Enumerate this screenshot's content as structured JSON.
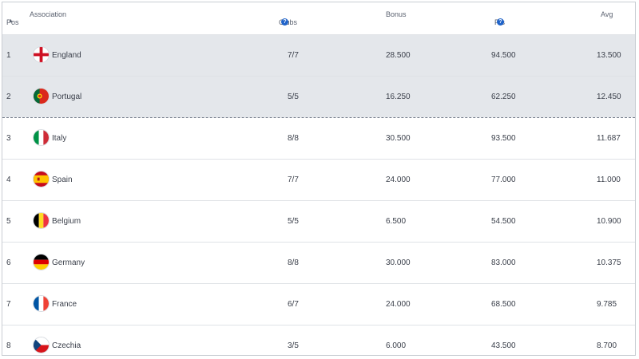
{
  "header": {
    "pos": "Pos",
    "association": "Association",
    "clubs": "Clubs",
    "bonus": "Bonus",
    "pts": "Pts",
    "avg": "Avg"
  },
  "rows": [
    {
      "pos": "1",
      "name": "England",
      "clubs": "7/7",
      "bonus": "28.500",
      "pts": "94.500",
      "avg": "13.500",
      "flag": "england-flag-icon"
    },
    {
      "pos": "2",
      "name": "Portugal",
      "clubs": "5/5",
      "bonus": "16.250",
      "pts": "62.250",
      "avg": "12.450",
      "flag": "portugal-flag-icon"
    },
    {
      "pos": "3",
      "name": "Italy",
      "clubs": "8/8",
      "bonus": "30.500",
      "pts": "93.500",
      "avg": "11.687",
      "flag": "italy-flag-icon"
    },
    {
      "pos": "4",
      "name": "Spain",
      "clubs": "7/7",
      "bonus": "24.000",
      "pts": "77.000",
      "avg": "11.000",
      "flag": "spain-flag-icon"
    },
    {
      "pos": "5",
      "name": "Belgium",
      "clubs": "5/5",
      "bonus": "6.500",
      "pts": "54.500",
      "avg": "10.900",
      "flag": "belgium-flag-icon"
    },
    {
      "pos": "6",
      "name": "Germany",
      "clubs": "8/8",
      "bonus": "30.000",
      "pts": "83.000",
      "avg": "10.375",
      "flag": "germany-flag-icon"
    },
    {
      "pos": "7",
      "name": "France",
      "clubs": "6/7",
      "bonus": "24.000",
      "pts": "68.500",
      "avg": "9.785",
      "flag": "france-flag-icon"
    },
    {
      "pos": "8",
      "name": "Czechia",
      "clubs": "3/5",
      "bonus": "6.000",
      "pts": "43.500",
      "avg": "8.700",
      "flag": "czechia-flag-icon"
    }
  ],
  "colors": {
    "highlight_row": "#e4e7eb",
    "help_icon": "#1f63c9",
    "divider": "#dfe2e6"
  }
}
